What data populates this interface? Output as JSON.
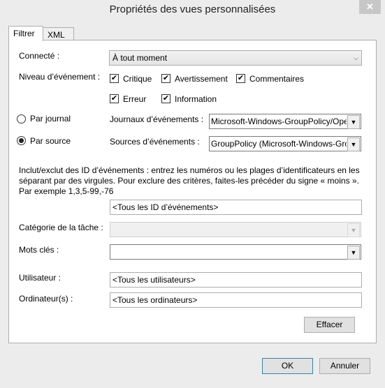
{
  "window": {
    "title": "Propriétés des vues personnalisées",
    "close_glyph": "✕"
  },
  "tabs": [
    {
      "label": "Filtrer"
    },
    {
      "label": "XML"
    }
  ],
  "form": {
    "connecte_label": "Connecté :",
    "connecte_value": "À tout moment",
    "niveau_label": "Niveau d’événement :",
    "levels": {
      "critique": {
        "label": "Critique",
        "checked": true
      },
      "avertissement": {
        "label": "Avertissement",
        "checked": true
      },
      "commentaires": {
        "label": "Commentaires",
        "checked": true
      },
      "erreur": {
        "label": "Erreur",
        "checked": true
      },
      "information": {
        "label": "Information",
        "checked": true
      }
    },
    "check_glyph": "✔",
    "radio_journal_label": "Par journal",
    "radio_source_label": "Par source",
    "journaux_label": "Journaux d’événements :",
    "journaux_value": "Microsoft-Windows-GroupPolicy/Operational",
    "sources_label": "Sources d’événements :",
    "sources_value": "GroupPolicy (Microsoft-Windows-GroupPolicy)",
    "id_description": "Inclut/exclut des ID d’événements : entrez les numéros ou les plages d’identificateurs en les séparant par des virgules. Pour exclure des critères, faites-les précéder du signe « moins ». Par exemple 1,3,5-99,-76",
    "id_value": "<Tous les ID d’événements>",
    "categorie_label": "Catégorie de la tâche :",
    "categorie_value": "",
    "mots_cles_label": "Mots clés :",
    "mots_cles_value": "",
    "utilisateur_label": "Utilisateur :",
    "utilisateur_value": "<Tous les utilisateurs>",
    "ordinateur_label": "Ordinateur(s) :",
    "ordinateur_value": "<Tous les ordinateurs>",
    "effacer_label": "Effacer"
  },
  "footer": {
    "ok_label": "OK",
    "annuler_label": "Annuler"
  },
  "dropdown_glyph": "▼"
}
